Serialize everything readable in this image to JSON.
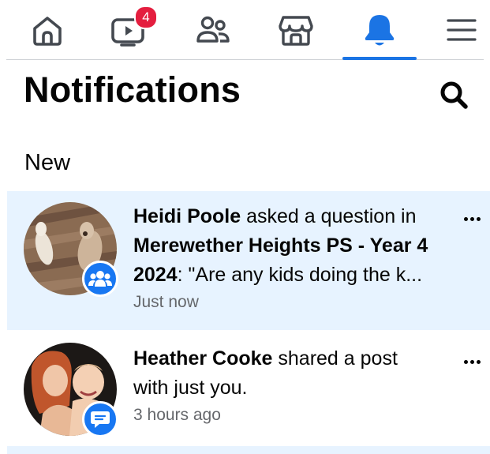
{
  "nav": {
    "items": [
      {
        "name": "home",
        "icon": "home-icon"
      },
      {
        "name": "watch",
        "icon": "video-icon",
        "badge": "4"
      },
      {
        "name": "friends",
        "icon": "friends-icon"
      },
      {
        "name": "marketplace",
        "icon": "marketplace-icon"
      },
      {
        "name": "notifications",
        "icon": "bell-icon",
        "active": true
      },
      {
        "name": "menu",
        "icon": "menu-icon"
      }
    ],
    "accent_color": "#1b74e4",
    "badge_color": "#e41e3f"
  },
  "header": {
    "title": "Notifications",
    "search_icon": "search-icon"
  },
  "section": {
    "label": "New"
  },
  "notifications": [
    {
      "actor": "Heidi Poole",
      "action": " asked a question in",
      "line2": "Merewether Heights PS - Year 4",
      "line3_bold": "2024",
      "line3_rest": ": \"Are any kids doing the k...",
      "time": "Just now",
      "overlay_icon": "group-icon",
      "unread": true
    },
    {
      "actor": "Heather Cooke",
      "action": " shared a post",
      "line2": "with just you.",
      "time": "3 hours ago",
      "overlay_icon": "message-icon",
      "unread": false
    }
  ]
}
